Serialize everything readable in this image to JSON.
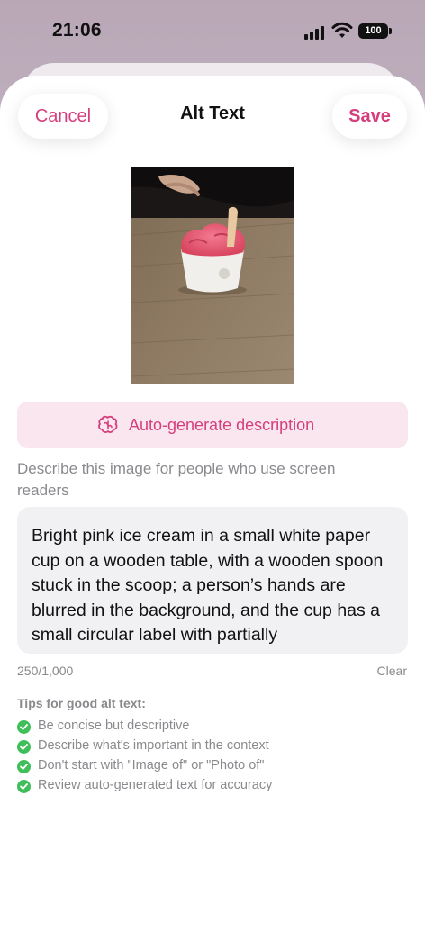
{
  "status_bar": {
    "time": "21:06",
    "battery": "100"
  },
  "header": {
    "cancel_label": "Cancel",
    "title": "Alt Text",
    "save_label": "Save"
  },
  "auto_generate": {
    "label": "Auto-generate description",
    "icon": "brain-icon"
  },
  "hint": "Describe this image for people who use screen readers",
  "alt_text": {
    "value": "Bright pink ice cream in a small white paper cup on a wooden table, with a wooden spoon stuck in the scoop; a person’s hands are blurred in the background, and the cup has a small circular label with partially",
    "counter": "250/1,000",
    "clear_label": "Clear"
  },
  "tips": {
    "heading": "Tips for good alt text:",
    "items": [
      {
        "label": "Be concise but descriptive"
      },
      {
        "label": "Describe what's important in the context"
      },
      {
        "label": "Don't start with \"Image of\" or \"Photo of\""
      },
      {
        "label": "Review auto-generated text for accuracy"
      }
    ]
  },
  "colors": {
    "accent": "#d63f7d",
    "accent_bg": "#f9e6ee",
    "check": "#3fbe5a",
    "muted": "#8a8a8e"
  }
}
